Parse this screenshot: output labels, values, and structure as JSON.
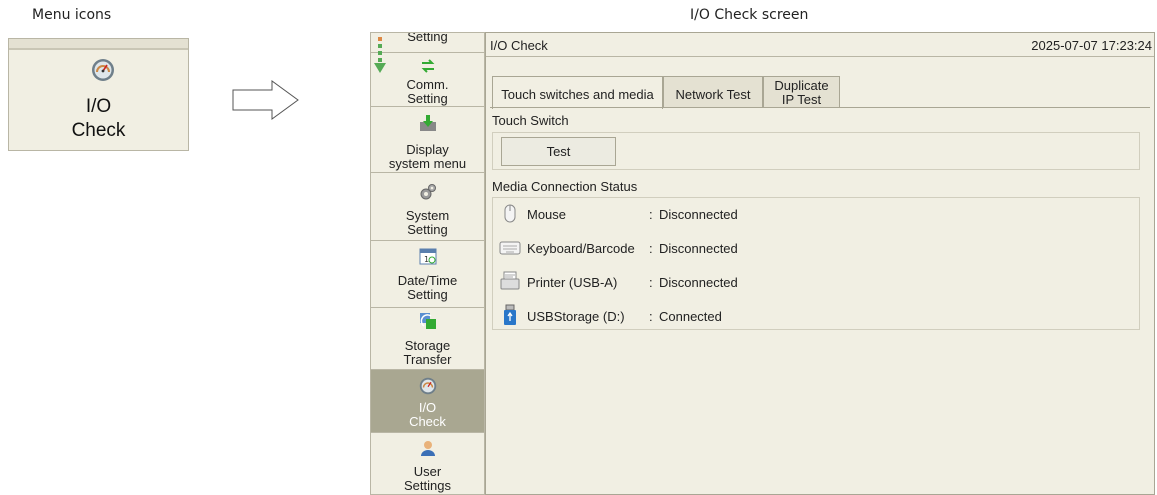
{
  "captions": {
    "left": "Menu icons",
    "right": "I/O Check screen"
  },
  "menu_icon": {
    "line1": "I/O",
    "line2": "Check",
    "icon": "gauge-icon"
  },
  "sidebar": {
    "items": [
      {
        "label1": "Setting",
        "label2": "",
        "icon": "setting-icon"
      },
      {
        "label1": "Comm.",
        "label2": "Setting",
        "icon": "comm-icon"
      },
      {
        "label1": "Display",
        "label2": "system menu",
        "icon": "download-icon"
      },
      {
        "label1": "System",
        "label2": "Setting",
        "icon": "gears-icon"
      },
      {
        "label1": "Date/Time",
        "label2": "Setting",
        "icon": "calendar-icon"
      },
      {
        "label1": "Storage",
        "label2": "Transfer",
        "icon": "transfer-icon"
      },
      {
        "label1": "I/O",
        "label2": "Check",
        "icon": "gauge-icon",
        "active": true
      },
      {
        "label1": "User",
        "label2": "Settings",
        "icon": "user-icon"
      }
    ]
  },
  "window": {
    "title": "I/O Check",
    "datetime": "2025-07-07  17:23:24"
  },
  "tabs": [
    {
      "label": "Touch switches and media",
      "active": true
    },
    {
      "label": "Network Test"
    },
    {
      "label": "Duplicate",
      "label2": "IP Test"
    }
  ],
  "touch_switch": {
    "title": "Touch Switch",
    "button": "Test"
  },
  "media": {
    "title": "Media Connection Status",
    "items": [
      {
        "name": "Mouse",
        "status": "Disconnected",
        "icon": "mouse-icon"
      },
      {
        "name": "Keyboard/Barcode",
        "status": "Disconnected",
        "icon": "keyboard-icon"
      },
      {
        "name": "Printer (USB-A)",
        "status": "Disconnected",
        "icon": "printer-icon"
      },
      {
        "name": "USBStorage (D:)",
        "status": "Connected",
        "icon": "usb-storage-icon"
      }
    ],
    "colon": ":"
  }
}
